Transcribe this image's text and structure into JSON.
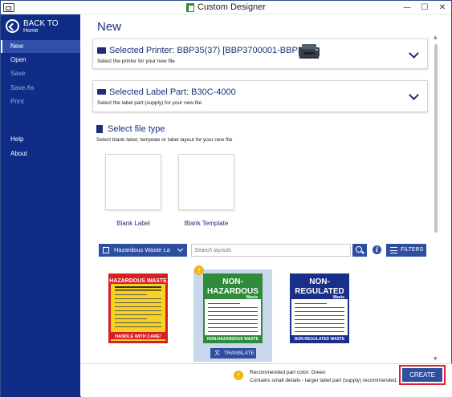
{
  "titlebar": {
    "title": "Custom Designer",
    "minimize": "—",
    "maximize": "☐",
    "close": "✕"
  },
  "sidebar": {
    "back_title": "BACK TO",
    "back_sub": "Home",
    "items": [
      {
        "label": "New",
        "state": "active"
      },
      {
        "label": "Open",
        "state": "normal"
      },
      {
        "label": "Save",
        "state": "disabled"
      },
      {
        "label": "Save As",
        "state": "disabled"
      },
      {
        "label": "Print",
        "state": "disabled"
      },
      {
        "label": "Help",
        "state": "normal"
      },
      {
        "label": "About",
        "state": "normal"
      }
    ]
  },
  "main": {
    "title": "New",
    "printer_card": {
      "title": "Selected Printer: BBP35(37) [BBP3700001-BBP37]",
      "subtitle": "Select the printer for your new file"
    },
    "label_card": {
      "title": "Selected Label Part: B30C-4000",
      "subtitle": "Select the label part (supply) for your new file"
    },
    "file_type": {
      "title": "Select file type",
      "subtitle": "Select blank label, template or label layout for your new file",
      "options": [
        {
          "label": "Blank Label"
        },
        {
          "label": "Blank Template"
        }
      ]
    },
    "filters": {
      "category": "Hazardous Waste La",
      "search_placeholder": "Search layouts",
      "info": "i",
      "filters_label": "FILTERS"
    },
    "layouts": [
      {
        "name": "hazardous-waste",
        "header": "HAZARDOUS WASTE",
        "footer": "HANDLE WITH CARE!",
        "bg": "#f7d21f",
        "border": "#d81f26"
      },
      {
        "name": "non-hazardous-waste",
        "header_line1": "NON-",
        "header_line2": "HAZARDOUS",
        "tag": "Waste",
        "footer": "NON-HAZARDOUS WASTE",
        "color": "#2f8a3a",
        "translate_label": "TRANSLATE"
      },
      {
        "name": "non-regulated-waste",
        "header_line1": "NON-",
        "header_line2": "REGULATED",
        "tag": "Waste",
        "footer": "NON-REGULATED WASTE",
        "color": "#1a2f8a"
      }
    ]
  },
  "bottom": {
    "recommendation_line1": "Recommended part color: Green",
    "recommendation_line2": "Contains small details - larger label part (supply) recommended.",
    "create_label": "CREATE"
  },
  "colors": {
    "sidebar": "#0f2c86",
    "accent": "#2e4fa0",
    "title": "#1b2f7a",
    "highlight": "#e0202a",
    "warning": "#f2b50f"
  }
}
